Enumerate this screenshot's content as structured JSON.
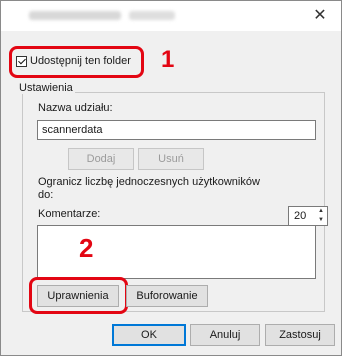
{
  "titlebar": {
    "close_symbol": "✕"
  },
  "share": {
    "checkbox_label": "Udostępnij ten folder",
    "checked": true
  },
  "settings": {
    "legend": "Ustawienia",
    "share_name_label": "Nazwa udziału:",
    "share_name_value": "scannerdata",
    "add_label": "Dodaj",
    "remove_label": "Usuń",
    "limit_label_line1": "Ogranicz liczbę jednoczesnych użytkowników",
    "limit_label_line2": "do:",
    "limit_value": "20",
    "comments_label": "Komentarze:",
    "comments_value": "",
    "permissions_label": "Uprawnienia",
    "caching_label": "Buforowanie"
  },
  "footer": {
    "ok_label": "OK",
    "cancel_label": "Anuluj",
    "apply_label": "Zastosuj"
  },
  "annotations": {
    "step1": "1",
    "step2": "2",
    "highlight_color": "#e30613"
  }
}
